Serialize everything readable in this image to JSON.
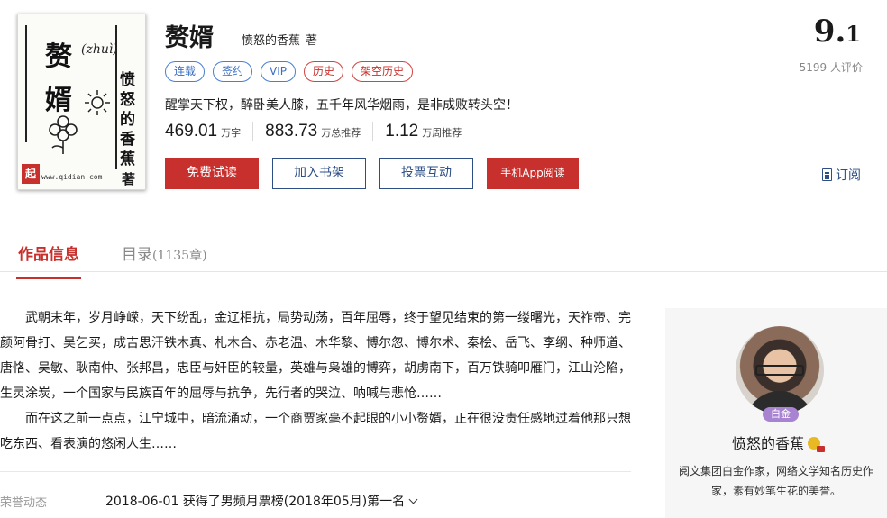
{
  "cover": {
    "title_chars": [
      "赘",
      "婿"
    ],
    "pinyin": "(zhuì)",
    "author_vertical": "愤怒的香蕉",
    "author_suffix": "著",
    "url": "www.qidian.com",
    "stamp": "起"
  },
  "book": {
    "title": "赘婿",
    "author": "愤怒的香蕉",
    "author_suffix": "著",
    "tags": [
      {
        "label": "连载",
        "color": "blue"
      },
      {
        "label": "签约",
        "color": "blue"
      },
      {
        "label": "VIP",
        "color": "blue"
      },
      {
        "label": "历史",
        "color": "red"
      },
      {
        "label": "架空历史",
        "color": "red"
      }
    ],
    "intro": "醒掌天下权，醉卧美人膝，五千年风华烟雨，是非成败转头空！",
    "stats": [
      {
        "num": "469.01",
        "unit": "万字"
      },
      {
        "num": "883.73",
        "unit": "万总推荐"
      },
      {
        "num": "1.12",
        "unit": "万周推荐"
      }
    ]
  },
  "buttons": {
    "free_read": "免费试读",
    "add_shelf": "加入书架",
    "vote": "投票互动",
    "app_read": "手机App阅读"
  },
  "score": {
    "int": "9.",
    "dec": "1",
    "count": "5199 人评价"
  },
  "subscribe": "订阅",
  "tabs": {
    "info": "作品信息",
    "catalog": "目录",
    "catalog_count": "(1135章)"
  },
  "description": {
    "para1": "武朝末年，岁月峥嵘，天下纷乱，金辽相抗，局势动荡，百年屈辱，终于望见结束的第一缕曙光，天祚帝、完颜阿骨打、吴乞买，成吉思汗铁木真、札木合、赤老温、木华黎、博尔忽、博尔术、秦桧、岳飞、李纲、种师道、唐恪、吴敏、耿南仲、张邦昌，忠臣与奸臣的较量，英雄与枭雄的博弈，胡虏南下，百万铁骑叩雁门，江山沦陷，生灵涂炭，一个国家与民族百年的屈辱与抗争，先行者的哭泣、呐喊与悲怆……",
    "para2": "而在这之前一点点，江宁城中，暗流涌动，一个商贾家毫不起眼的小小赘婿，正在很没责任感地过着他那只想吃东西、看表演的悠闲人生……"
  },
  "honor": {
    "label": "荣誉动态",
    "text": "2018-06-01 获得了男频月票榜(2018年05月)第一名"
  },
  "author_panel": {
    "badge": "白金",
    "name": "愤怒的香蕉",
    "desc": "阅文集团白金作家，网络文学知名历史作家，素有妙笔生花的美誉。"
  },
  "colors": {
    "accent_red": "#c8302d",
    "accent_blue": "#2e4f86",
    "tag_blue": "#3a6fc4",
    "badge_purple": "#a883d1"
  }
}
